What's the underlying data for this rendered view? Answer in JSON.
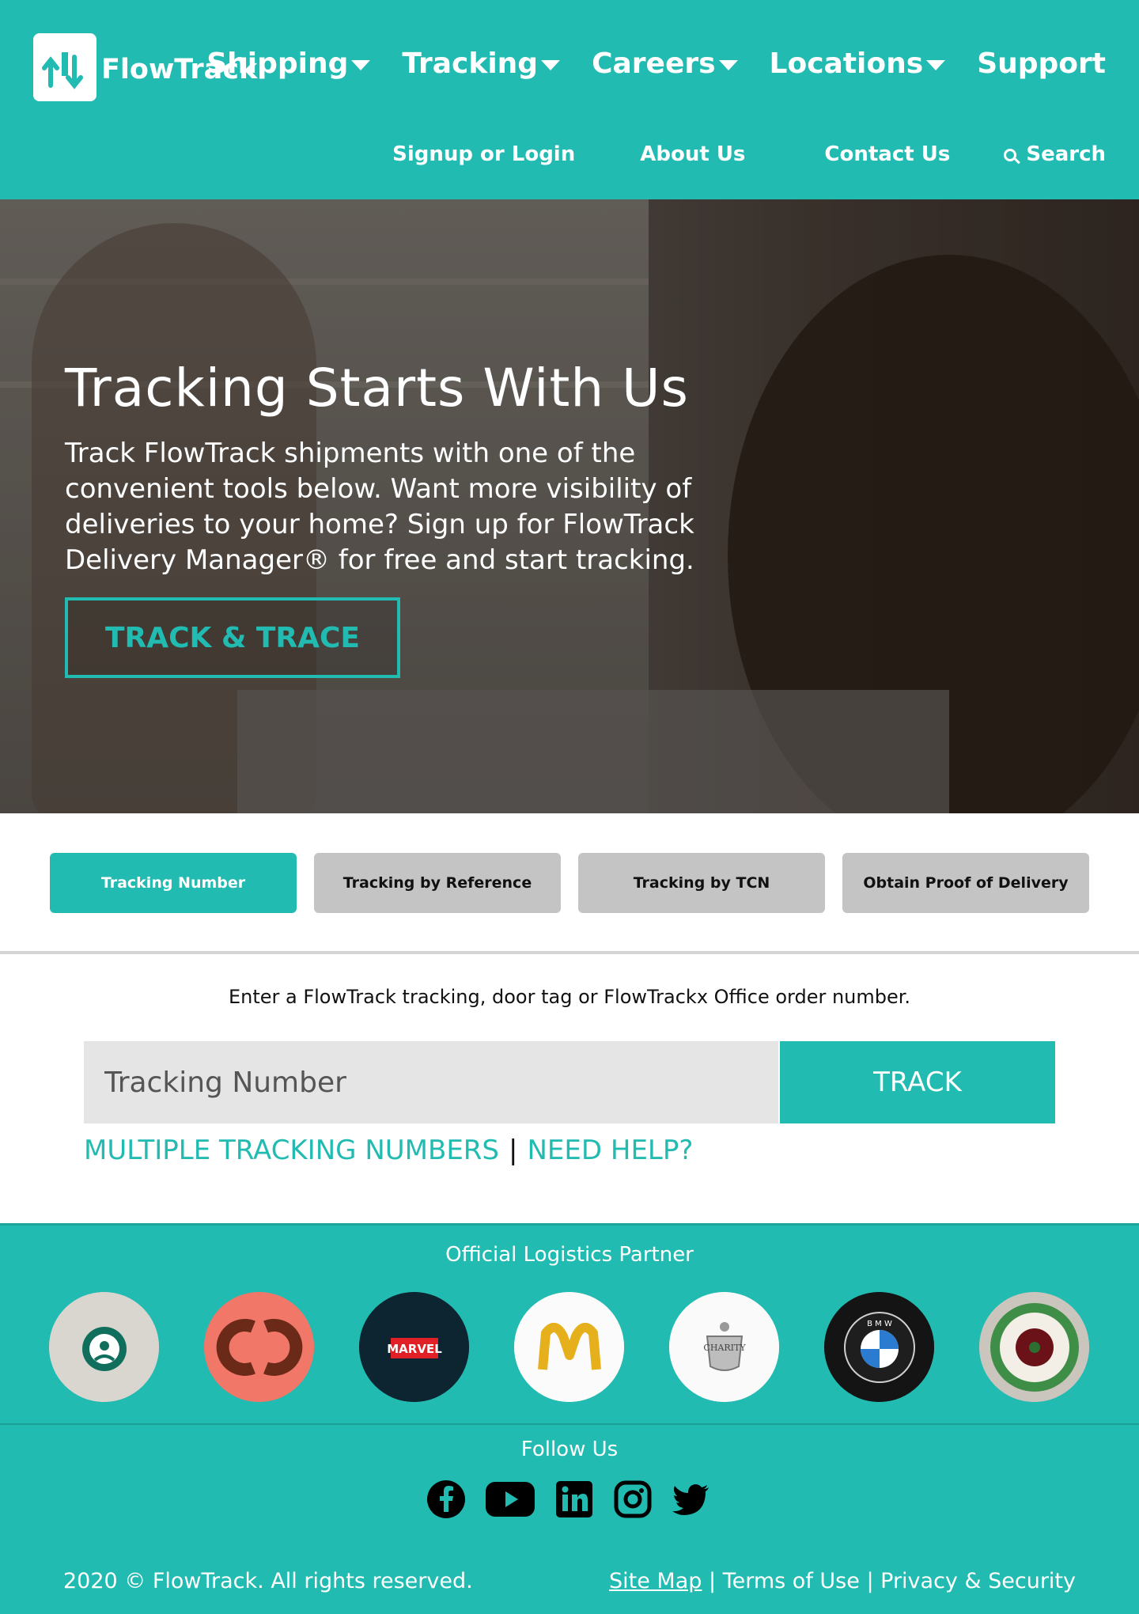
{
  "brand": {
    "name": "FlowTrack",
    "accent": "#22bbb1"
  },
  "nav": {
    "main": [
      {
        "label": "Shipping",
        "dropdown": true
      },
      {
        "label": "Tracking",
        "dropdown": true
      },
      {
        "label": "Careers",
        "dropdown": true
      },
      {
        "label": "Locations",
        "dropdown": true
      },
      {
        "label": "Support",
        "dropdown": false
      }
    ],
    "sub": {
      "signup": "Signup or Login",
      "about": "About Us",
      "contact": "Contact Us",
      "search": "Search"
    }
  },
  "hero": {
    "title": "Tracking Starts With Us",
    "text": "Track FlowTrack shipments with one of the convenient tools below. Want more visibility of deliveries to your home? Sign up for FlowTrack Delivery Manager® for free and start tracking.",
    "button": "TRACK & TRACE"
  },
  "tabs": [
    {
      "label": "Tracking Number",
      "active": true
    },
    {
      "label": "Tracking by Reference",
      "active": false
    },
    {
      "label": "Tracking by TCN",
      "active": false
    },
    {
      "label": "Obtain Proof of Delivery",
      "active": false
    }
  ],
  "track": {
    "description": "Enter a FlowTrack tracking, door tag or FlowTrackx Office order number.",
    "placeholder": "Tracking Number",
    "button": "TRACK",
    "link_multiple": "MULTIPLE TRACKING NUMBERS",
    "separator": "|",
    "link_help": "NEED HELP?"
  },
  "partners": {
    "title": "Official Logistics Partner",
    "logos": [
      "starbucks-logo",
      "cc-logo",
      "marvel-logo",
      "mcdonalds-logo",
      "charity-logo",
      "bmw-logo",
      "suffrage-logo"
    ],
    "marvel_text": "MARVEL",
    "charity_text": "CHARITY",
    "bmw_text": "B M W"
  },
  "footer": {
    "follow_title": "Follow Us",
    "social": [
      "facebook-icon",
      "youtube-icon",
      "linkedin-icon",
      "instagram-icon",
      "twitter-icon"
    ],
    "copyright": "2020 © FlowTrack. All rights reserved.",
    "links": {
      "sitemap": "Site Map",
      "terms": "Terms of Use",
      "privacy": "Privacy & Security",
      "sep": "|"
    }
  }
}
